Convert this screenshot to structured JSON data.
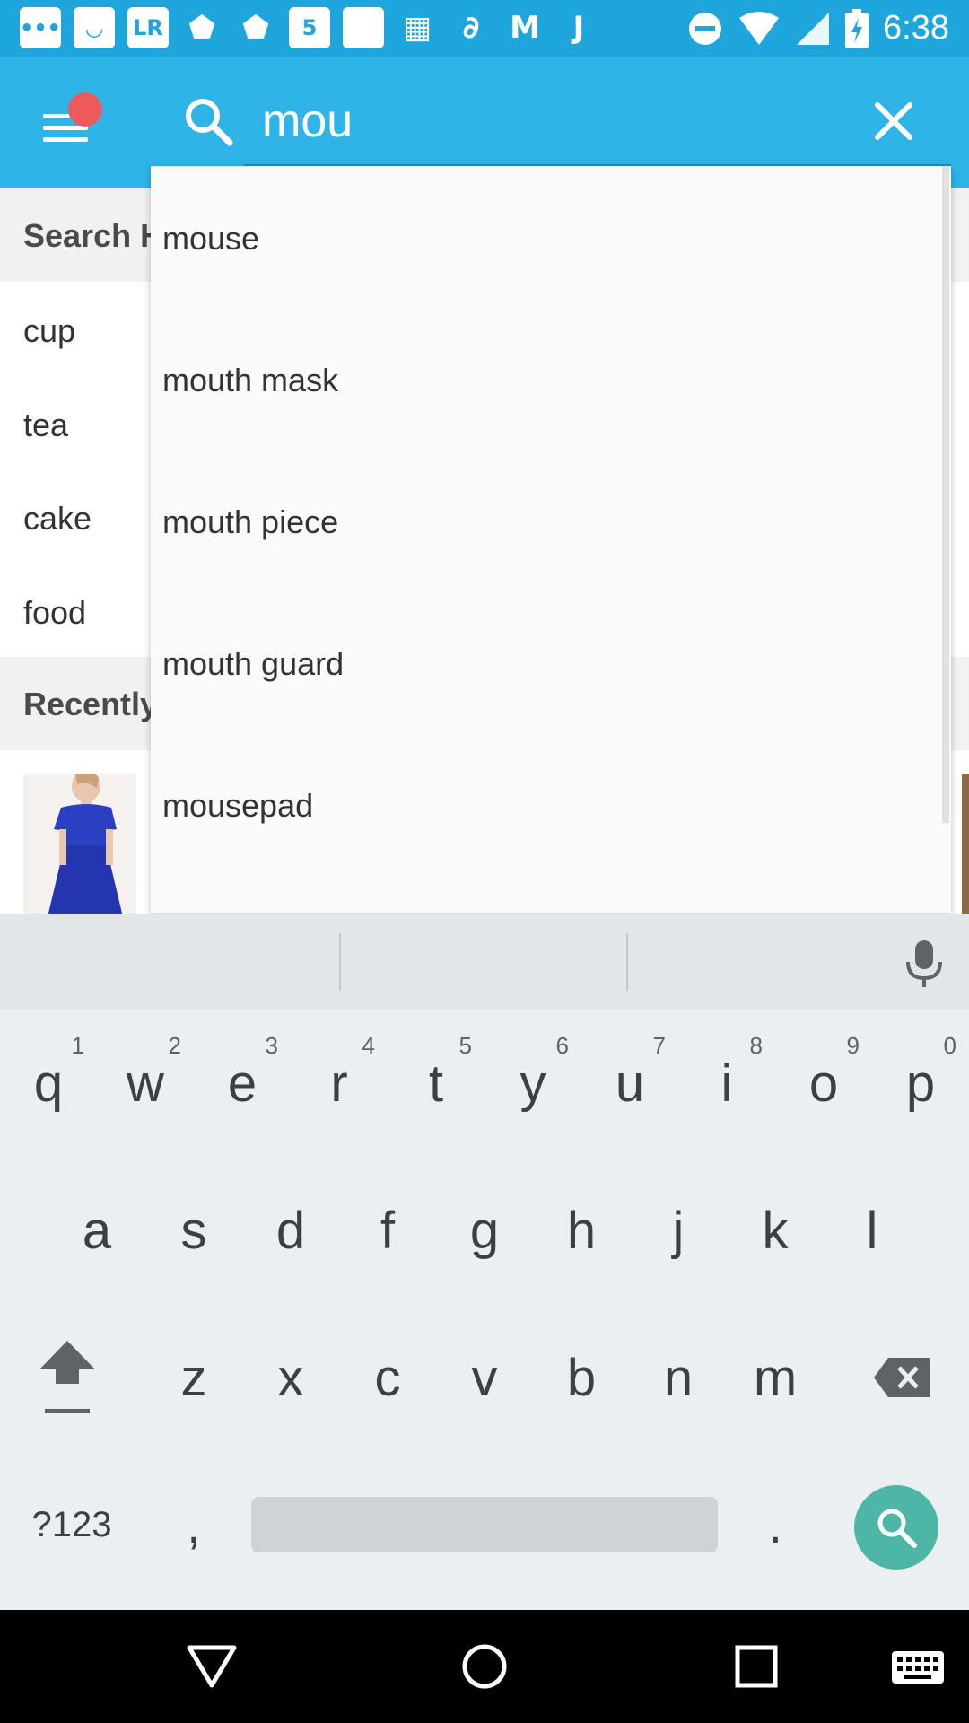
{
  "status_bar": {
    "time": "6:38",
    "icons": [
      "chat-icon",
      "smile-app-icon",
      "lr-app-icon",
      "drive-icon",
      "drive-icon",
      "five-app-icon",
      "blank-app-icon",
      "grid-app-icon",
      "link-app-icon",
      "m-app-icon",
      "j-app-icon"
    ],
    "lr_label": "LR",
    "five_label": "5",
    "m_label": "M",
    "j_label": "J"
  },
  "search": {
    "value": "mou"
  },
  "page": {
    "search_history_title": "Search History",
    "history_items": [
      "cup",
      "tea",
      "cake",
      "food"
    ],
    "recently_title": "Recently Viewed"
  },
  "suggestions": [
    "mouse",
    "mouth mask",
    "mouth piece",
    "mouth guard",
    "mousepad"
  ],
  "keyboard": {
    "row1": [
      {
        "key": "q",
        "hint": "1"
      },
      {
        "key": "w",
        "hint": "2"
      },
      {
        "key": "e",
        "hint": "3"
      },
      {
        "key": "r",
        "hint": "4"
      },
      {
        "key": "t",
        "hint": "5"
      },
      {
        "key": "y",
        "hint": "6"
      },
      {
        "key": "u",
        "hint": "7"
      },
      {
        "key": "i",
        "hint": "8"
      },
      {
        "key": "o",
        "hint": "9"
      },
      {
        "key": "p",
        "hint": "0"
      }
    ],
    "row2": [
      "a",
      "s",
      "d",
      "f",
      "g",
      "h",
      "j",
      "k",
      "l"
    ],
    "row3": [
      "z",
      "x",
      "c",
      "v",
      "b",
      "n",
      "m"
    ],
    "symbols_label": "?123",
    "comma": ",",
    "period": "."
  },
  "colors": {
    "app_bar": "#2fb4e8",
    "status_bar": "#1ea6dc",
    "search_key": "#4db6a6",
    "notification_dot": "#ee5a5a"
  }
}
